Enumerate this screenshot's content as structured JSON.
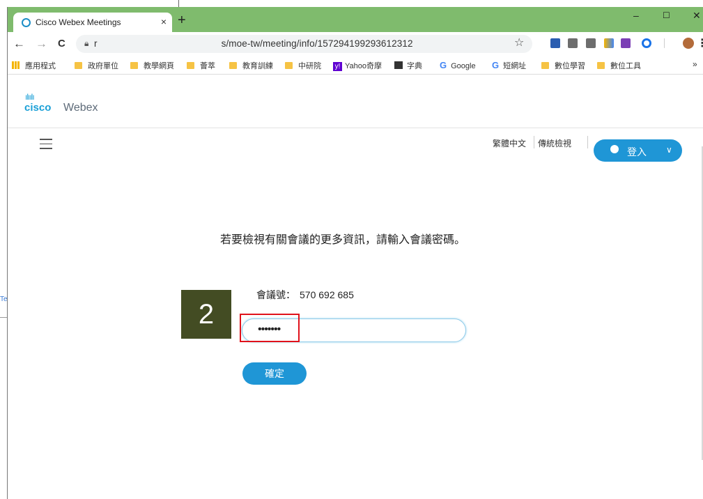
{
  "background": {
    "left_text": "Te"
  },
  "browser": {
    "tab_title": "Cisco Webex Meetings",
    "tab_close": "×",
    "new_tab": "+",
    "window": {
      "minimize": "–",
      "maximize": "☐",
      "close": "✕"
    },
    "nav": {
      "back": "←",
      "forward": "→",
      "reload": "C"
    },
    "url_prefix": "r",
    "url": "s/moe-tw/meeting/info/157294199293612312",
    "bookmarks": [
      "應用程式",
      "政府單位",
      "教學網頁",
      "薈萃",
      "教育訓練",
      "中研院",
      "Yahoo奇摩",
      "字典",
      "Google",
      "短網址",
      "數位學習",
      "數位工具"
    ],
    "bookmarks_more": "»"
  },
  "site": {
    "logo_bars": "ılıılı",
    "logo_cisco": "cisco",
    "logo_webex": "Webex",
    "language": "繁體中文",
    "classic_view": "傳統檢視",
    "signin": "登入"
  },
  "main": {
    "prompt": "若要檢視有關會議的更多資訊，請輸入會議密碼。",
    "meeting_label": "會議號：",
    "meeting_number": "570 692 685",
    "password_mask": "•••••••",
    "confirm": "確定"
  },
  "annotation": {
    "step_number": "2"
  },
  "colors": {
    "tab_bar": "#7fbb6d",
    "webex_blue": "#1f96d6",
    "highlight": "#e0121b",
    "step_box": "#434c23"
  }
}
